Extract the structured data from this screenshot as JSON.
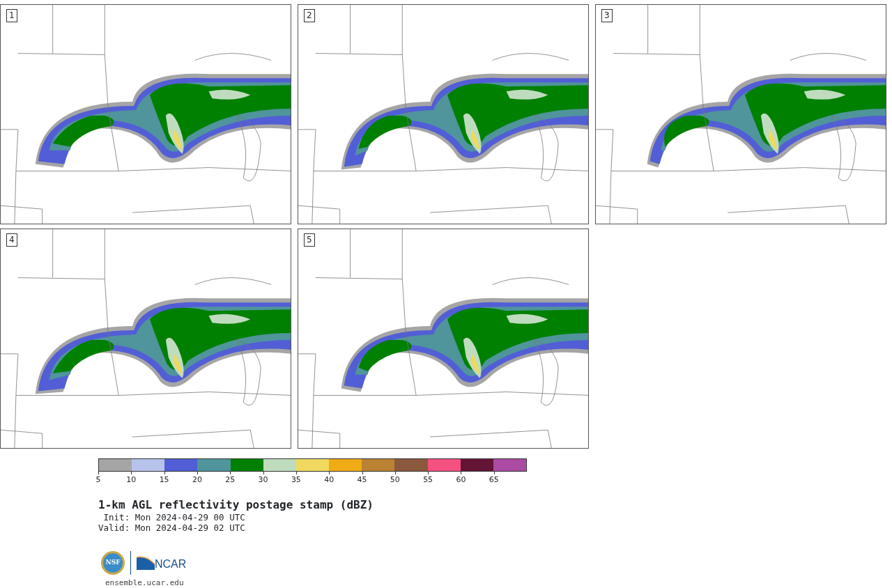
{
  "panels": [
    {
      "label": "1"
    },
    {
      "label": "2"
    },
    {
      "label": "3"
    },
    {
      "label": "4"
    },
    {
      "label": "5"
    }
  ],
  "colorbar": {
    "bins": [
      {
        "color": "#a5a5a5"
      },
      {
        "color": "#b8c3ec"
      },
      {
        "color": "#525ed6"
      },
      {
        "color": "#4f959b"
      },
      {
        "color": "#008000"
      },
      {
        "color": "#bfdcbf"
      },
      {
        "color": "#f0d95e"
      },
      {
        "color": "#f0ac16"
      },
      {
        "color": "#bb8233"
      },
      {
        "color": "#8b593e"
      },
      {
        "color": "#f45080"
      },
      {
        "color": "#631535"
      },
      {
        "color": "#ab4ba4"
      }
    ],
    "ticks": [
      "5",
      "10",
      "15",
      "20",
      "25",
      "30",
      "35",
      "40",
      "45",
      "50",
      "55",
      "60",
      "65"
    ]
  },
  "title": "1-km AGL reflectivity postage stamp (dBZ)",
  "init": " Init: Mon 2024-04-29 00 UTC",
  "valid": "Valid: Mon 2024-04-29 02 UTC",
  "logo": {
    "left": "NSF",
    "right": "NCAR"
  },
  "footer": "ensemble.ucar.edu"
}
